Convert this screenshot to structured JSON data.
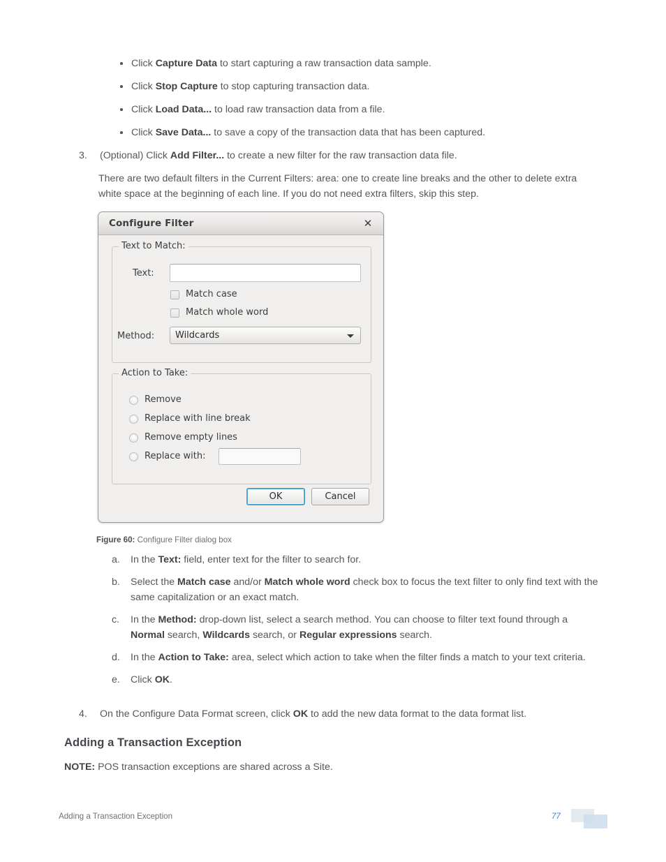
{
  "document": {
    "bullets": [
      {
        "prefix": "Click ",
        "bold": "Capture Data",
        "suffix": " to start capturing a raw transaction data sample."
      },
      {
        "prefix": "Click ",
        "bold": "Stop Capture",
        "suffix": " to stop capturing transaction data."
      },
      {
        "prefix": "Click ",
        "bold": "Load Data...",
        "suffix": " to load raw transaction data from a file."
      },
      {
        "prefix": "Click ",
        "bold": "Save Data...",
        "suffix": " to save a copy of the transaction data that has been captured."
      }
    ],
    "step3": {
      "number": "3.",
      "prefix": "(Optional) Click ",
      "bold": "Add Filter...",
      "suffix": " to create a new filter for the raw transaction data file.",
      "paragraph": "There are two default filters in the Current Filters: area: one to create line breaks and the other to delete extra white space at the beginning of each line. If you do not need extra filters, skip this step."
    },
    "substeps": [
      {
        "letter": "a.",
        "p1": "In the ",
        "b1": "Text:",
        "p2": " field, enter text for the filter to search for.",
        "b2": "",
        "p3": "",
        "b3": "",
        "p4": ""
      },
      {
        "letter": "b.",
        "p1": "Select the ",
        "b1": "Match case",
        "p2": " and/or ",
        "b2": "Match whole word",
        "p3": " check box to focus the text filter to only find text with the same capitalization or an exact match.",
        "b3": "",
        "p4": ""
      },
      {
        "letter": "c.",
        "p1": "In the ",
        "b1": "Method:",
        "p2": " drop-down list, select a search method. You can choose to filter text found through a ",
        "b2": "Normal",
        "p3": " search, ",
        "b3": "Wildcards",
        "p4": " search, or ",
        "b4": "Regular expressions",
        "p5": " search."
      },
      {
        "letter": "d.",
        "p1": "In the ",
        "b1": "Action to Take:",
        "p2": " area, select which action to take when the filter finds a match to your text criteria.",
        "b2": "",
        "p3": "",
        "b3": "",
        "p4": ""
      },
      {
        "letter": "e.",
        "p1": "Click ",
        "b1": "OK",
        "p2": ".",
        "b2": "",
        "p3": "",
        "b3": "",
        "p4": ""
      }
    ],
    "step4": {
      "number": "4.",
      "prefix": "On the Configure Data Format screen, click ",
      "bold": "OK",
      "suffix": " to add the new data format to the data format list."
    },
    "figure_caption": {
      "label": "Figure 60:",
      "text": " Configure Filter dialog box"
    },
    "heading": "Adding a Transaction Exception",
    "note": {
      "label": "NOTE:",
      "text": " POS transaction exceptions are shared across a Site."
    },
    "footer": {
      "left": "Adding a Transaction Exception",
      "page_number": "77"
    }
  },
  "dialog": {
    "title": "Configure Filter",
    "close_icon": "close-icon",
    "groups": {
      "text_to_match": {
        "legend": "Text to Match:",
        "text_label": "Text:",
        "text_value": "",
        "text_placeholder": "",
        "checkboxes": [
          {
            "label": "Match case",
            "checked": false
          },
          {
            "label": "Match whole word",
            "checked": false
          }
        ],
        "method_label": "Method:",
        "method_value": "Wildcards",
        "method_options": [
          "Normal",
          "Wildcards",
          "Regular expressions"
        ]
      },
      "action_to_take": {
        "legend": "Action to Take:",
        "radios": [
          {
            "label": "Remove",
            "selected": false
          },
          {
            "label": "Replace with line break",
            "selected": false
          },
          {
            "label": "Remove empty lines",
            "selected": false
          },
          {
            "label": "Replace with:",
            "selected": false
          }
        ],
        "replace_with_value": ""
      }
    },
    "buttons": {
      "ok": "OK",
      "cancel": "Cancel"
    }
  },
  "colors": {
    "accent_blue": "#4da2d8",
    "page_number_blue": "#3f7fd6",
    "body_text": "#53575b",
    "dialog_bg": "#f0efee"
  }
}
